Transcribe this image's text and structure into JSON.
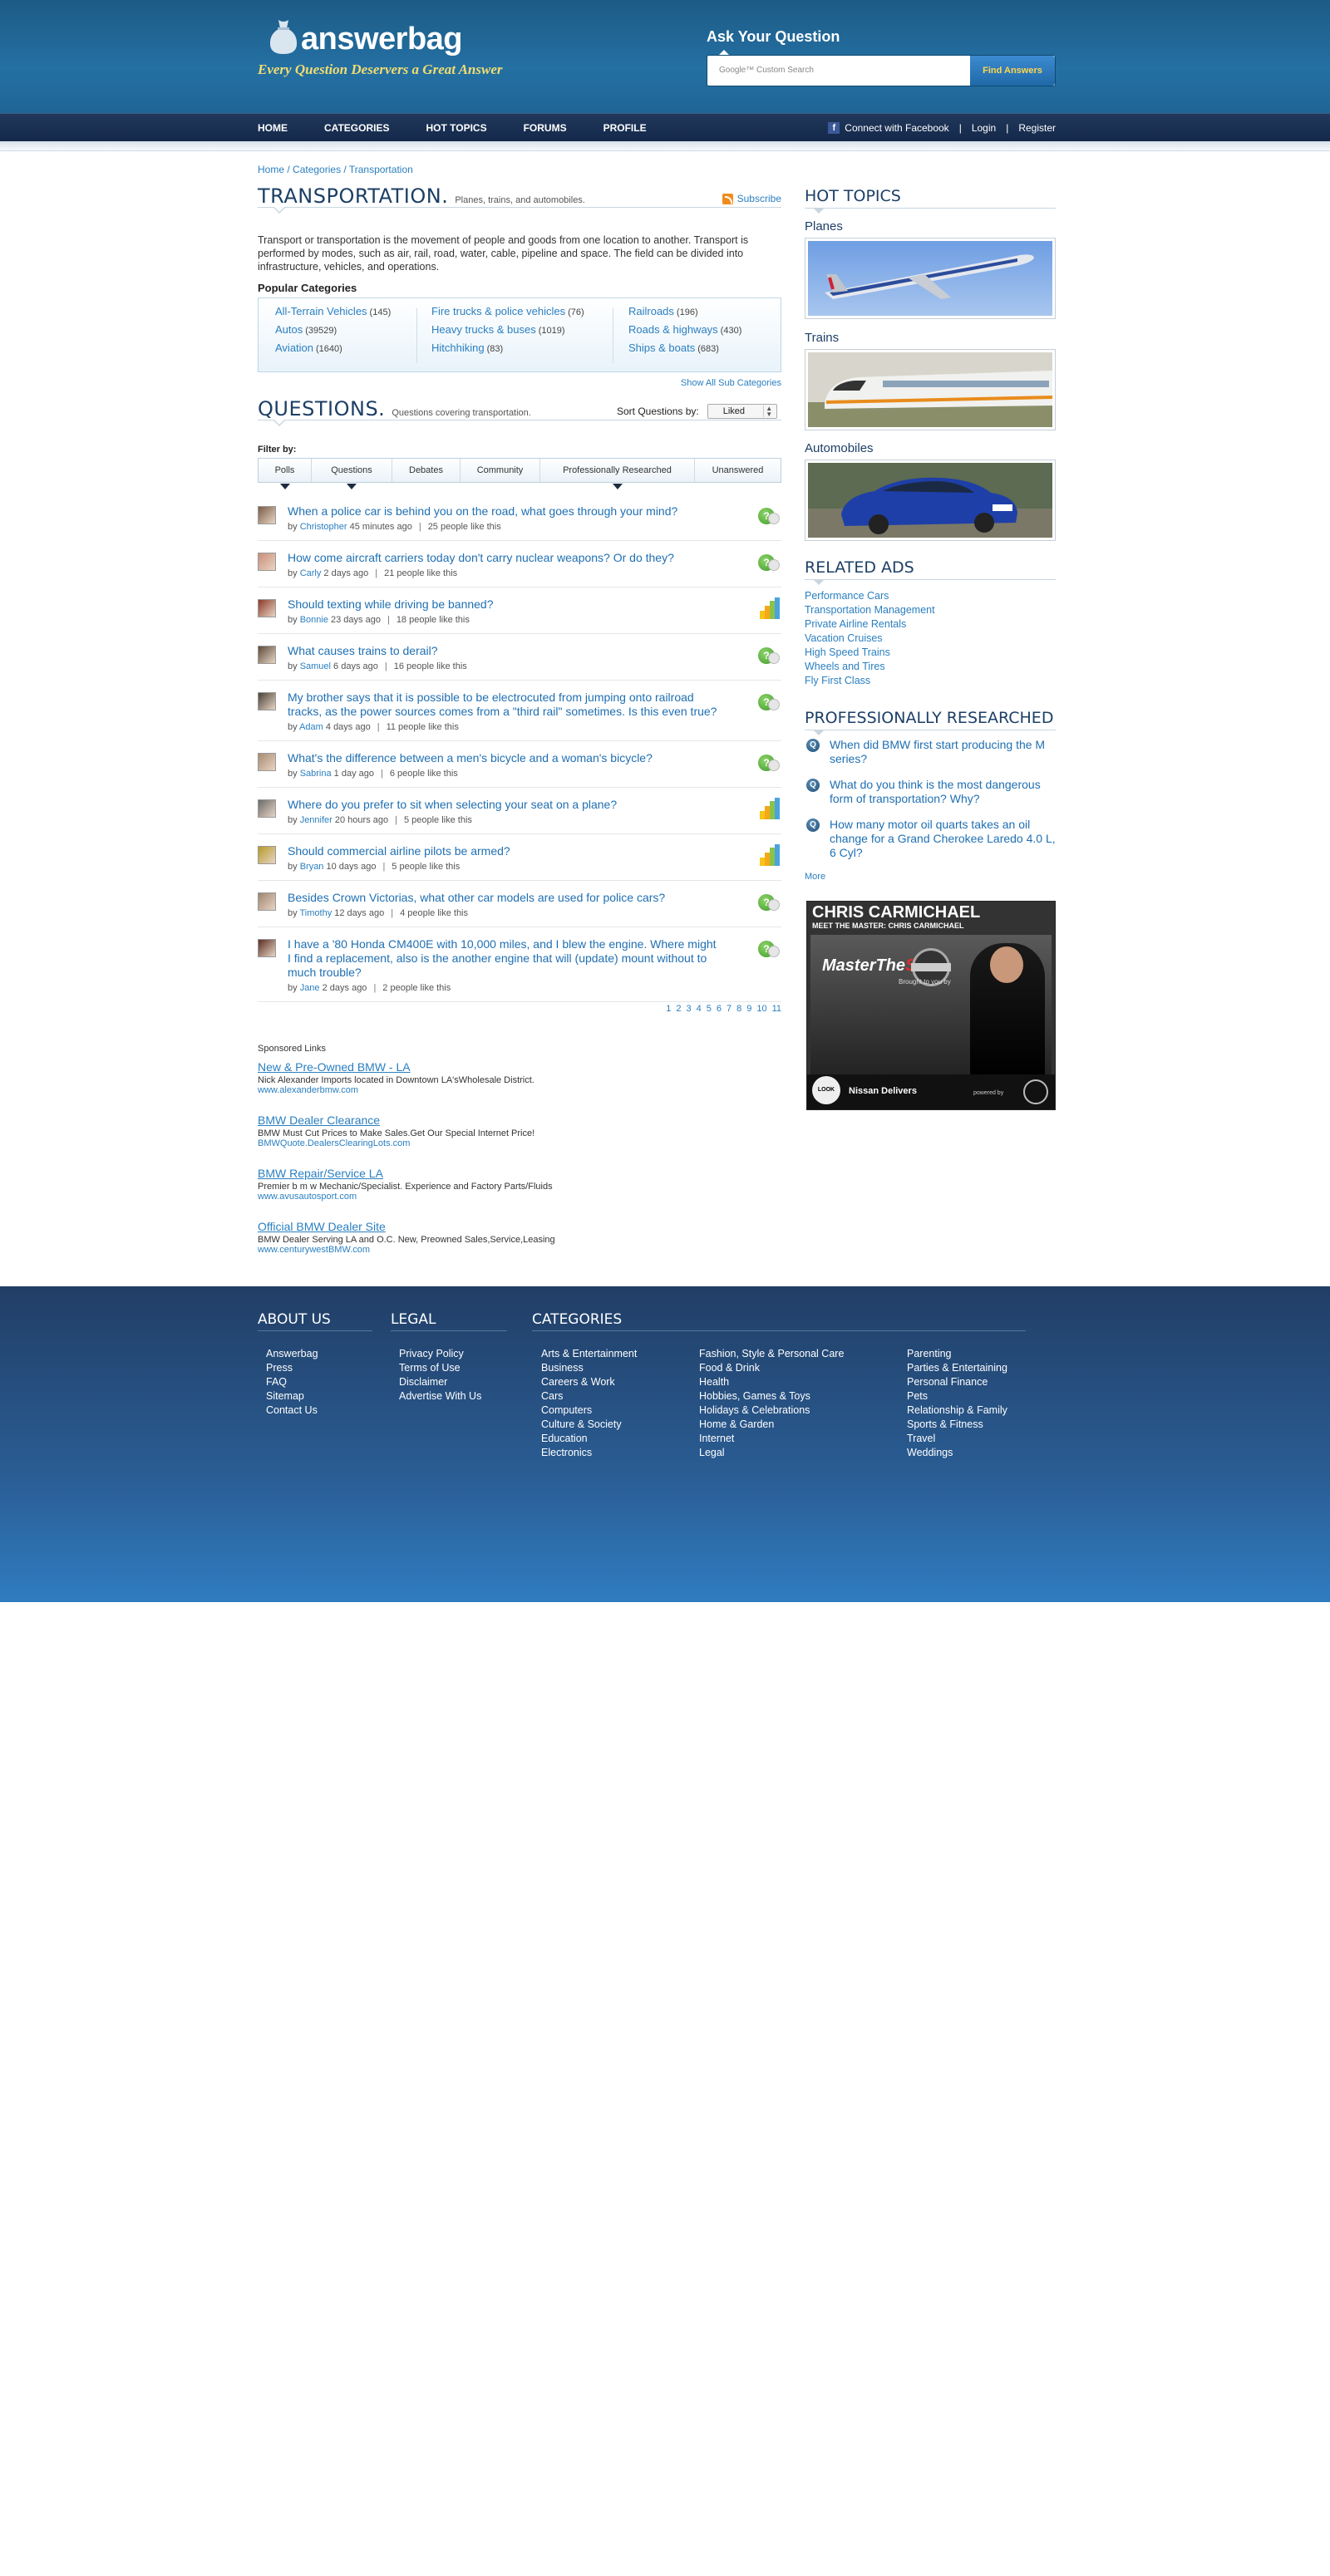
{
  "header": {
    "logo_text": "answerbag",
    "tagline": "Every Question Deservers a Great Answer",
    "ask_title": "Ask Your Question",
    "search_placeholder": "Google™ Custom Search",
    "find_button": "Find Answers"
  },
  "nav": {
    "items": [
      "HOME",
      "CATEGORIES",
      "HOT TOPICS",
      "FORUMS",
      "PROFILE"
    ],
    "facebook": "Connect with Facebook",
    "login": "Login",
    "register": "Register",
    "sep": "|"
  },
  "breadcrumb": [
    "Home",
    "Categories",
    "Transportation"
  ],
  "breadcrumb_sep": " / ",
  "category": {
    "title": "TRANSPORTATION.",
    "subtitle": "Planes, trains, and automobiles.",
    "subscribe": "Subscribe",
    "description": "Transport or transportation is the movement of people and goods from one location to another. Transport is performed by modes, such as air, rail, road, water, cable, pipeline and space. The field can be divided into infrastructure, vehicles, and operations.",
    "popular_title": "Popular Categories",
    "popular": [
      [
        {
          "name": "All-Terrain Vehicles",
          "count": "(145)"
        },
        {
          "name": "Autos",
          "count": "(39529)"
        },
        {
          "name": "Aviation",
          "count": "(1640)"
        }
      ],
      [
        {
          "name": "Fire trucks & police vehicles",
          "count": "(76)"
        },
        {
          "name": "Heavy trucks & buses",
          "count": "(1019)"
        },
        {
          "name": "Hitchhiking",
          "count": "(83)"
        }
      ],
      [
        {
          "name": "Railroads",
          "count": "(196)"
        },
        {
          "name": "Roads & highways",
          "count": "(430)"
        },
        {
          "name": "Ships & boats",
          "count": "(683)"
        }
      ]
    ],
    "show_all": "Show All Sub Categories"
  },
  "questions": {
    "title": "QUESTIONS.",
    "subtitle": "Questions covering transportation.",
    "sort_label": "Sort Questions by:",
    "sort_value": "Liked",
    "filter_label": "Filter by:",
    "tabs": [
      {
        "label": "Polls",
        "active": true
      },
      {
        "label": "Questions",
        "active": true
      },
      {
        "label": "Debates",
        "active": false
      },
      {
        "label": "Community",
        "active": false
      },
      {
        "label": "Professionally Researched",
        "active": true
      },
      {
        "label": "Unanswered",
        "active": false
      }
    ],
    "items": [
      {
        "title": "When a police car is behind you on the road, what goes through your mind?",
        "user": "Christopher",
        "time": "45 minutes ago",
        "likes": "25 people like this",
        "type": "question"
      },
      {
        "title": "How come aircraft carriers today don't carry nuclear weapons? Or do they?",
        "user": "Carly",
        "time": "2 days ago",
        "likes": "21 people like this",
        "type": "question"
      },
      {
        "title": "Should texting while driving be banned?",
        "user": "Bonnie",
        "time": "23 days ago",
        "likes": "18 people like this",
        "type": "poll"
      },
      {
        "title": "What causes trains to derail?",
        "user": "Samuel",
        "time": "6 days ago",
        "likes": "16 people like this",
        "type": "question"
      },
      {
        "title": "My brother says that it is possible to be electrocuted from jumping onto railroad tracks, as the power sources comes from a \"third rail\" sometimes. Is this even true?",
        "user": "Adam",
        "time": "4 days ago",
        "likes": "11 people like this",
        "type": "question"
      },
      {
        "title": "What's the difference between a men's bicycle and a woman's bicycle?",
        "user": "Sabrina",
        "time": "1 day ago",
        "likes": "6 people like this",
        "type": "question"
      },
      {
        "title": "Where do you prefer to sit when selecting your seat on a plane?",
        "user": "Jennifer",
        "time": "20 hours ago",
        "likes": "5 people like this",
        "type": "poll"
      },
      {
        "title": "Should commercial airline pilots be armed?",
        "user": "Bryan",
        "time": "10 days ago",
        "likes": "5 people like this",
        "type": "poll"
      },
      {
        "title": "Besides Crown Victorias, what other car models are used for police cars?",
        "user": "Timothy",
        "time": "12 days ago",
        "likes": "4 people like this",
        "type": "question"
      },
      {
        "title": "I have a '80 Honda CM400E with 10,000 miles, and I blew the engine. Where might I find a replacement, also is the another engine that will (update) mount without to much trouble?",
        "user": "Jane",
        "time": "2 days ago",
        "likes": "2 people like this",
        "type": "question"
      }
    ],
    "by": "by",
    "pages": [
      "1",
      "2",
      "3",
      "4",
      "5",
      "6",
      "7",
      "8",
      "9",
      "10",
      "11"
    ]
  },
  "sponsored": {
    "label": "Sponsored Links",
    "ads": [
      {
        "title": "New & Pre-Owned BMW - LA",
        "desc": "Nick Alexander Imports located in Downtown LA'sWholesale District.",
        "url": "www.alexanderbmw.com"
      },
      {
        "title": "BMW Dealer Clearance",
        "desc": "BMW Must Cut Prices to Make Sales.Get Our Special Internet Price!",
        "url": "BMWQuote.DealersClearingLots.com"
      },
      {
        "title": "BMW Repair/Service LA",
        "desc": "Premier b m w Mechanic/Specialist. Experience and Factory Parts/Fluids",
        "url": "www.avusautosport.com"
      },
      {
        "title": "Official BMW Dealer Site",
        "desc": "BMW Dealer Serving LA and O.C. New, Preowned Sales,Service,Leasing",
        "url": "www.centurywestBMW.com"
      }
    ]
  },
  "sidebar": {
    "hot_title": "HOT TOPICS",
    "hot": [
      "Planes",
      "Trains",
      "Automobiles"
    ],
    "ads_title": "RELATED ADS",
    "ads": [
      "Performance Cars",
      "Transportation Management",
      "Private Airline Rentals",
      "Vacation Cruises",
      "High Speed Trains",
      "Wheels and Tires",
      "Fly First Class"
    ],
    "pr_title": "PROFESSIONALLY RESEARCHED",
    "pr": [
      "When did BMW first start producing the M series?",
      "What do you think is the most dangerous form of transportation? Why?",
      "How many motor oil quarts takes an oil change for a Grand Cherokee Laredo 4.0 L, 6 Cyl?"
    ],
    "more": "More",
    "banner": {
      "name": "CHRIS CARMICHAEL",
      "sub": "MEET THE MASTER: CHRIS CARMICHAEL",
      "brand_a": "MasterThe",
      "brand_b": "Shift",
      "brought": "Brought to you by",
      "look": "LOOK INSIDE",
      "delivers": "Nissan Delivers",
      "powered": "powered by"
    }
  },
  "footer": {
    "about_title": "ABOUT US",
    "about": [
      "Answerbag",
      "Press",
      "FAQ",
      "Sitemap",
      "Contact Us"
    ],
    "legal_title": "LEGAL",
    "legal": [
      "Privacy Policy",
      "Terms of Use",
      "Disclaimer",
      "Advertise With Us"
    ],
    "cat_title": "CATEGORIES",
    "cat_col1": [
      "Arts & Entertainment",
      "Business",
      "Careers & Work",
      "Cars",
      "Computers",
      "Culture & Society",
      "Education",
      "Electronics"
    ],
    "cat_col2": [
      "Fashion, Style & Personal Care",
      "Food & Drink",
      "Health",
      "Hobbies, Games & Toys",
      "Holidays & Celebrations",
      "Home & Garden",
      "Internet",
      "Legal"
    ],
    "cat_col3": [
      "Parenting",
      "Parties & Entertaining",
      "Personal Finance",
      "Pets",
      "Relationship & Family",
      "Sports & Fitness",
      "Travel",
      "Weddings"
    ]
  },
  "colors": {
    "brand_blue": "#1f6596",
    "link": "#2a7fc0",
    "tagline_gold": "#f3dc70"
  }
}
